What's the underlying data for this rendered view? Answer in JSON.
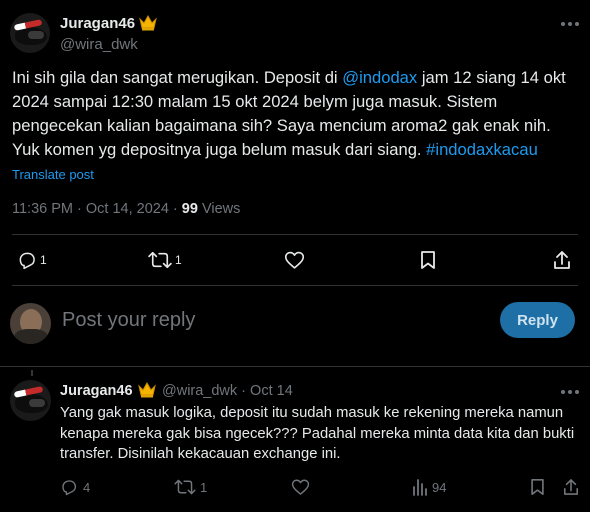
{
  "main_post": {
    "author_name": "Juragan46",
    "author_handle": "@wira_dwk",
    "text_before": "Ini sih gila dan sangat merugikan. Deposit di ",
    "mention": "@indodax",
    "text_middle": " jam 12 siang 14 okt 2024 sampai 12:30 malam 15 okt 2024 belym juga masuk. Sistem pengecekan kalian bagaimana sih? Saya mencium aroma2 gak enak nih. Yuk komen yg depositnya juga belum masuk dari siang. ",
    "hashtag": "#indodaxkacau",
    "translate_label": "Translate post",
    "timestamp": "11:36 PM · Oct 14, 2024",
    "separator": " · ",
    "views_count": "99",
    "views_label": " Views",
    "actions": {
      "reply_count": "1",
      "retweet_count": "1",
      "like_count": "",
      "bookmark_count": ""
    }
  },
  "composer": {
    "placeholder": "Post your reply",
    "button_label": "Reply"
  },
  "reply_post": {
    "author_name": "Juragan46",
    "author_handle": "@wira_dwk",
    "dot": " · ",
    "date": "Oct 14",
    "text": "Yang gak masuk logika, deposit itu sudah masuk ke rekening mereka namun kenapa mereka gak bisa ngecek??? Padahal mereka minta data kita dan bukti transfer. Disinilah kekacauan exchange ini.",
    "actions": {
      "reply_count": "4",
      "retweet_count": "1",
      "views_count": "94"
    }
  },
  "colors": {
    "background": "#000000",
    "text": "#e7e9ea",
    "muted": "#71767b",
    "accent": "#1d9bf0",
    "divider": "#2f3336"
  },
  "icons": [
    "crown-icon",
    "more-icon",
    "reply-icon",
    "retweet-icon",
    "like-icon",
    "bookmark-icon",
    "share-icon",
    "views-icon"
  ]
}
